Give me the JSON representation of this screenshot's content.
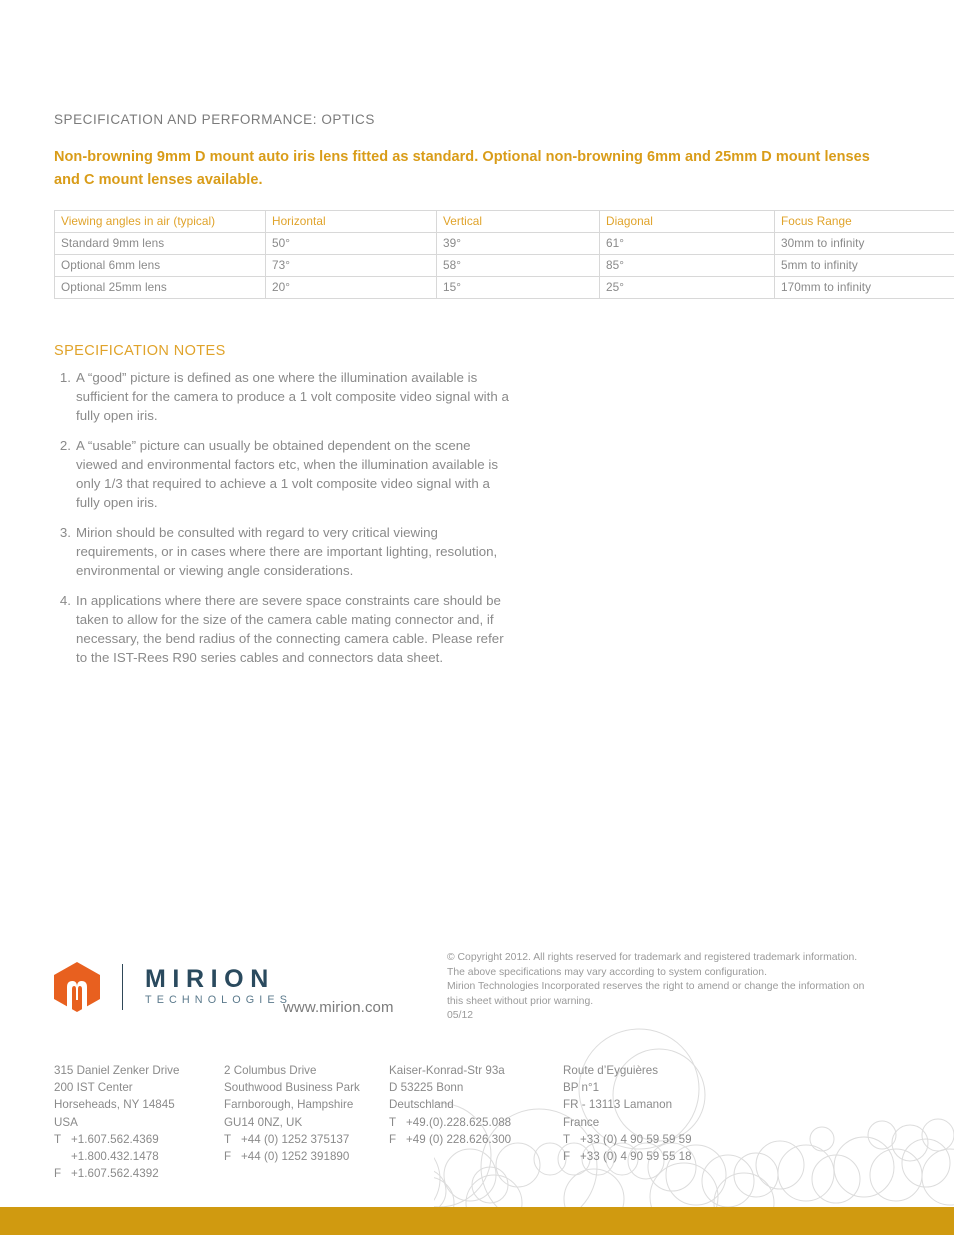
{
  "section": {
    "heading": "SPECIFICATION AND PERFORMANCE: OPTICS",
    "lead": "Non-browning 9mm D mount auto iris lens fitted as standard. Optional non-browning 6mm and 25mm D mount lenses and C mount lenses available."
  },
  "table": {
    "headers": [
      "Viewing angles in air (typical)",
      "Horizontal",
      "Vertical",
      "Diagonal",
      "Focus Range"
    ],
    "rows": [
      [
        "Standard 9mm lens",
        "50°",
        "39°",
        "61°",
        "30mm to infinity"
      ],
      [
        "Optional 6mm lens",
        "73°",
        "58°",
        "85°",
        "5mm to infinity"
      ],
      [
        "Optional 25mm lens",
        "20°",
        "15°",
        "25°",
        "170mm to infinity"
      ]
    ]
  },
  "notes": {
    "heading": "SPECIFICATION NOTES",
    "items": [
      {
        "num": "1.",
        "text": "A “good” picture is defined as one where the illumination available is sufficient for the camera to produce a 1 volt composite video signal with a fully open iris."
      },
      {
        "num": "2.",
        "text": "A “usable” picture can usually be obtained dependent on the scene viewed and environmental factors etc, when the illumination available is only 1/3 that required to achieve a 1 volt composite video signal with a fully open iris."
      },
      {
        "num": "3.",
        "text": "Mirion should be consulted with regard to very critical viewing requirements, or in cases where there are important lighting, resolution, environmental or viewing angle considerations."
      },
      {
        "num": "4.",
        "text": "In applications where there are severe space constraints care should be taken to allow for the size of the camera cable mating connector and, if necessary, the bend radius of the connecting camera cable. Please refer to the IST-Rees R90 series cables and connectors data sheet."
      }
    ]
  },
  "footer": {
    "logo_name": "MIRION",
    "logo_sub": "TECHNOLOGIES",
    "website": "www.mirion.com",
    "copyright": "© Copyright 2012.  All rights reserved for trademark and registered trademark information. The above specifications may vary according to system configuration. Mirion Technologies Incorporated reserves the right to amend or change the information on this sheet without prior warning. 05/12",
    "copyright_lines": [
      "© Copyright 2012.  All rights reserved for trademark and registered trademark information.",
      "The above specifications may vary according to system configuration.",
      "Mirion Technologies Incorporated reserves the right to amend or change the information on",
      "this sheet without prior warning.",
      "05/12"
    ],
    "addresses": [
      {
        "lines": [
          "315 Daniel Zenker Drive",
          "200 IST Center",
          "Horseheads, NY 14845",
          "USA"
        ],
        "phones": [
          {
            "label": "T",
            "value": "+1.607.562.4369"
          },
          {
            "label": "",
            "value": "+1.800.432.1478"
          },
          {
            "label": "F",
            "value": "+1.607.562.4392"
          }
        ]
      },
      {
        "lines": [
          "2 Columbus Drive",
          "Southwood Business Park",
          "Farnborough, Hampshire",
          "GU14 0NZ, UK"
        ],
        "phones": [
          {
            "label": "T",
            "value": "+44 (0) 1252 375137"
          },
          {
            "label": "F",
            "value": "+44 (0) 1252 391890"
          }
        ]
      },
      {
        "lines": [
          "Kaiser-Konrad-Str 93a",
          "D 53225 Bonn",
          "Deutschland"
        ],
        "phones": [
          {
            "label": "T",
            "value": "+49.(0).228.625.088"
          },
          {
            "label": "F",
            "value": "+49 (0) 228.626.300"
          }
        ]
      },
      {
        "lines": [
          "Route d’Eyguières",
          "BP n°1",
          "FR - 13113 Lamanon",
          "France"
        ],
        "phones": [
          {
            "label": "T",
            "value": "+33 (0) 4 90 59 59 59"
          },
          {
            "label": "F",
            "value": "+33 (0) 4 90 59 55 18"
          }
        ]
      }
    ]
  },
  "colors": {
    "gold": "#d09a10",
    "table_header": "#e0a32a",
    "lead": "#d99c18",
    "body_gray": "#8a8a8a",
    "logo_orange": "#e8601f",
    "logo_navy": "#2a4a5e"
  }
}
